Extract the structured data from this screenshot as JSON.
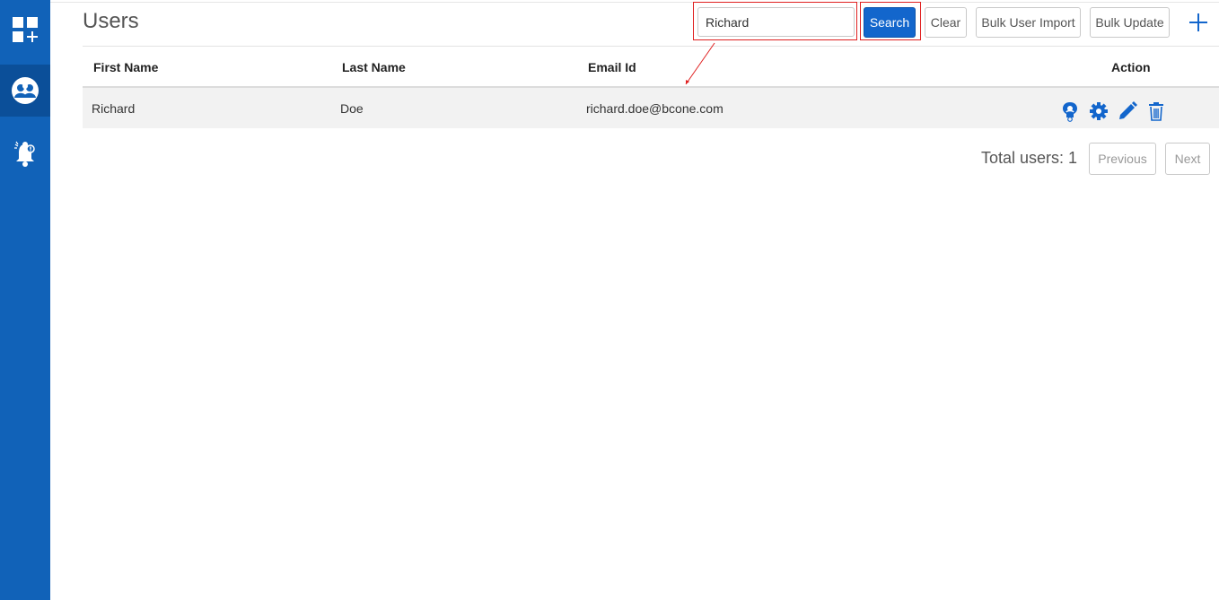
{
  "sidebar": {
    "items": [
      {
        "name": "dashboard",
        "icon": "dashboard-add-icon",
        "active": false
      },
      {
        "name": "users",
        "icon": "users-group-icon",
        "active": true
      },
      {
        "name": "notifications",
        "icon": "bell-alert-icon",
        "active": false
      }
    ]
  },
  "header": {
    "title": "Users",
    "search": {
      "value": "Richard",
      "placeholder": ""
    },
    "search_label": "Search",
    "clear_label": "Clear",
    "bulk_import_label": "Bulk User Import",
    "bulk_update_label": "Bulk Update",
    "add_icon": "plus-icon"
  },
  "table": {
    "columns": [
      "First Name",
      "Last Name",
      "Email Id",
      "Action"
    ],
    "rows": [
      {
        "first_name": "Richard",
        "last_name": "Doe",
        "email": "richard.doe@bcone.com",
        "actions": [
          "user-access-icon",
          "gear-icon",
          "pencil-icon",
          "trash-icon"
        ]
      }
    ]
  },
  "pagination": {
    "total_label": "Total users: 1",
    "previous_label": "Previous",
    "next_label": "Next"
  },
  "colors": {
    "sidebar": "#1162b8",
    "primary": "#1366cc",
    "highlight": "#e02020",
    "row_bg": "#f2f2f2"
  }
}
